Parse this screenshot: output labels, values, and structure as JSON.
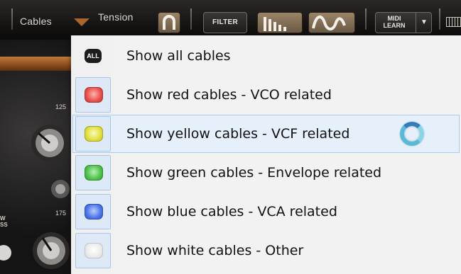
{
  "toolbar": {
    "cables_label": "Cables",
    "tension_label": "Tension",
    "filter_label": "FILTER",
    "midi_learn_label": "MIDI\nLEARN"
  },
  "panel": {
    "knob_values": [
      "125",
      "175"
    ],
    "side_text": [
      "W",
      "SS"
    ]
  },
  "menu": {
    "items": [
      {
        "label": "Show all cables",
        "badge": "ALL",
        "color": "#1c1c1c"
      },
      {
        "label": "Show red cables - VCO related",
        "color": "#e8534f"
      },
      {
        "label": "Show yellow cables - VCF related",
        "color": "#e2df45"
      },
      {
        "label": "Show green cables - Envelope related",
        "color": "#52c24e"
      },
      {
        "label": "Show blue cables - VCA related",
        "color": "#4f78e8"
      },
      {
        "label": "Show white cables - Other",
        "color": "#ececec"
      }
    ]
  },
  "colors": {
    "menu_bg": "#f2f2f2",
    "hover_bg": "#e6f0fb",
    "hover_border": "#a9cbee",
    "wood": "#a8652c",
    "toolbar_button": "#8a7458"
  }
}
